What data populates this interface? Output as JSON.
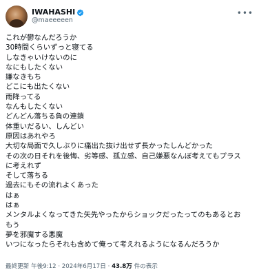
{
  "author": {
    "display_name": "IWAHASHI",
    "handle": "@maeeeeen",
    "verified": true,
    "avatar_icon": "avatar-photo"
  },
  "menu_icon": "more-horizontal-icon",
  "body_lines": [
    "これが鬱なんだろうか",
    "30時間くらいずっと寝てる",
    "しなきゃいけないのに",
    "なにもしたくない",
    "嫌なきもち",
    "どこにも出たくない",
    "雨降ってる",
    "なんもしたくない",
    "どんどん落ちる負の連鎖",
    "体重いだるい、しんどい",
    "原因はあれやろ",
    "大切な局面で久しぶりに痛出た抜け出せず長かったしんどかった",
    "その次の日それを後悔、劣等感、孤立感、自己嫌悪なんぼ考えてもプラス",
    "に考えれず",
    "そして落ちる",
    "過去にもその流れよくあった",
    "はぁ",
    "はぁ",
    "メンタルよくなってきた矢先やったからショックだったってのもあるとお",
    "もう",
    "夢を邪魔する悪魔",
    "いつになったらそれも含めて俺って考えれるようになるんだろうか"
  ],
  "meta": {
    "timestamp": "午後9:12 · 2024年6月17日",
    "separator": " · ",
    "views_count": "43.8万",
    "views_label": " 件の表示",
    "last_updated_label": "最終更新 "
  },
  "colors": {
    "text": "#0f1419",
    "secondary": "#536471",
    "verified": "#1d9bf0"
  }
}
